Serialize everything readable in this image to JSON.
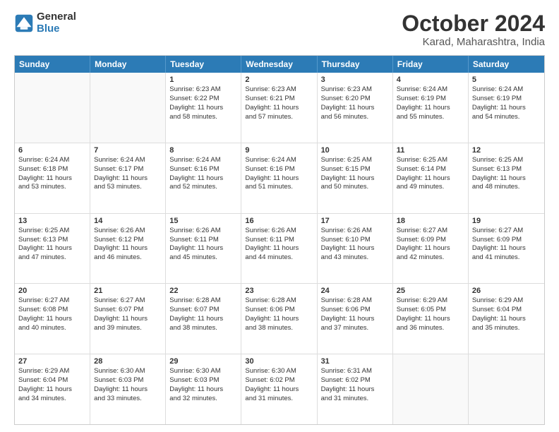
{
  "logo": {
    "line1": "General",
    "line2": "Blue"
  },
  "title": "October 2024",
  "subtitle": "Karad, Maharashtra, India",
  "weekdays": [
    "Sunday",
    "Monday",
    "Tuesday",
    "Wednesday",
    "Thursday",
    "Friday",
    "Saturday"
  ],
  "rows": [
    [
      {
        "day": "",
        "lines": [],
        "empty": true
      },
      {
        "day": "",
        "lines": [],
        "empty": true
      },
      {
        "day": "1",
        "lines": [
          "Sunrise: 6:23 AM",
          "Sunset: 6:22 PM",
          "Daylight: 11 hours",
          "and 58 minutes."
        ]
      },
      {
        "day": "2",
        "lines": [
          "Sunrise: 6:23 AM",
          "Sunset: 6:21 PM",
          "Daylight: 11 hours",
          "and 57 minutes."
        ]
      },
      {
        "day": "3",
        "lines": [
          "Sunrise: 6:23 AM",
          "Sunset: 6:20 PM",
          "Daylight: 11 hours",
          "and 56 minutes."
        ]
      },
      {
        "day": "4",
        "lines": [
          "Sunrise: 6:24 AM",
          "Sunset: 6:19 PM",
          "Daylight: 11 hours",
          "and 55 minutes."
        ]
      },
      {
        "day": "5",
        "lines": [
          "Sunrise: 6:24 AM",
          "Sunset: 6:19 PM",
          "Daylight: 11 hours",
          "and 54 minutes."
        ]
      }
    ],
    [
      {
        "day": "6",
        "lines": [
          "Sunrise: 6:24 AM",
          "Sunset: 6:18 PM",
          "Daylight: 11 hours",
          "and 53 minutes."
        ]
      },
      {
        "day": "7",
        "lines": [
          "Sunrise: 6:24 AM",
          "Sunset: 6:17 PM",
          "Daylight: 11 hours",
          "and 53 minutes."
        ]
      },
      {
        "day": "8",
        "lines": [
          "Sunrise: 6:24 AM",
          "Sunset: 6:16 PM",
          "Daylight: 11 hours",
          "and 52 minutes."
        ]
      },
      {
        "day": "9",
        "lines": [
          "Sunrise: 6:24 AM",
          "Sunset: 6:16 PM",
          "Daylight: 11 hours",
          "and 51 minutes."
        ]
      },
      {
        "day": "10",
        "lines": [
          "Sunrise: 6:25 AM",
          "Sunset: 6:15 PM",
          "Daylight: 11 hours",
          "and 50 minutes."
        ]
      },
      {
        "day": "11",
        "lines": [
          "Sunrise: 6:25 AM",
          "Sunset: 6:14 PM",
          "Daylight: 11 hours",
          "and 49 minutes."
        ]
      },
      {
        "day": "12",
        "lines": [
          "Sunrise: 6:25 AM",
          "Sunset: 6:13 PM",
          "Daylight: 11 hours",
          "and 48 minutes."
        ]
      }
    ],
    [
      {
        "day": "13",
        "lines": [
          "Sunrise: 6:25 AM",
          "Sunset: 6:13 PM",
          "Daylight: 11 hours",
          "and 47 minutes."
        ]
      },
      {
        "day": "14",
        "lines": [
          "Sunrise: 6:26 AM",
          "Sunset: 6:12 PM",
          "Daylight: 11 hours",
          "and 46 minutes."
        ]
      },
      {
        "day": "15",
        "lines": [
          "Sunrise: 6:26 AM",
          "Sunset: 6:11 PM",
          "Daylight: 11 hours",
          "and 45 minutes."
        ]
      },
      {
        "day": "16",
        "lines": [
          "Sunrise: 6:26 AM",
          "Sunset: 6:11 PM",
          "Daylight: 11 hours",
          "and 44 minutes."
        ]
      },
      {
        "day": "17",
        "lines": [
          "Sunrise: 6:26 AM",
          "Sunset: 6:10 PM",
          "Daylight: 11 hours",
          "and 43 minutes."
        ]
      },
      {
        "day": "18",
        "lines": [
          "Sunrise: 6:27 AM",
          "Sunset: 6:09 PM",
          "Daylight: 11 hours",
          "and 42 minutes."
        ]
      },
      {
        "day": "19",
        "lines": [
          "Sunrise: 6:27 AM",
          "Sunset: 6:09 PM",
          "Daylight: 11 hours",
          "and 41 minutes."
        ]
      }
    ],
    [
      {
        "day": "20",
        "lines": [
          "Sunrise: 6:27 AM",
          "Sunset: 6:08 PM",
          "Daylight: 11 hours",
          "and 40 minutes."
        ]
      },
      {
        "day": "21",
        "lines": [
          "Sunrise: 6:27 AM",
          "Sunset: 6:07 PM",
          "Daylight: 11 hours",
          "and 39 minutes."
        ]
      },
      {
        "day": "22",
        "lines": [
          "Sunrise: 6:28 AM",
          "Sunset: 6:07 PM",
          "Daylight: 11 hours",
          "and 38 minutes."
        ]
      },
      {
        "day": "23",
        "lines": [
          "Sunrise: 6:28 AM",
          "Sunset: 6:06 PM",
          "Daylight: 11 hours",
          "and 38 minutes."
        ]
      },
      {
        "day": "24",
        "lines": [
          "Sunrise: 6:28 AM",
          "Sunset: 6:06 PM",
          "Daylight: 11 hours",
          "and 37 minutes."
        ]
      },
      {
        "day": "25",
        "lines": [
          "Sunrise: 6:29 AM",
          "Sunset: 6:05 PM",
          "Daylight: 11 hours",
          "and 36 minutes."
        ]
      },
      {
        "day": "26",
        "lines": [
          "Sunrise: 6:29 AM",
          "Sunset: 6:04 PM",
          "Daylight: 11 hours",
          "and 35 minutes."
        ]
      }
    ],
    [
      {
        "day": "27",
        "lines": [
          "Sunrise: 6:29 AM",
          "Sunset: 6:04 PM",
          "Daylight: 11 hours",
          "and 34 minutes."
        ]
      },
      {
        "day": "28",
        "lines": [
          "Sunrise: 6:30 AM",
          "Sunset: 6:03 PM",
          "Daylight: 11 hours",
          "and 33 minutes."
        ]
      },
      {
        "day": "29",
        "lines": [
          "Sunrise: 6:30 AM",
          "Sunset: 6:03 PM",
          "Daylight: 11 hours",
          "and 32 minutes."
        ]
      },
      {
        "day": "30",
        "lines": [
          "Sunrise: 6:30 AM",
          "Sunset: 6:02 PM",
          "Daylight: 11 hours",
          "and 31 minutes."
        ]
      },
      {
        "day": "31",
        "lines": [
          "Sunrise: 6:31 AM",
          "Sunset: 6:02 PM",
          "Daylight: 11 hours",
          "and 31 minutes."
        ]
      },
      {
        "day": "",
        "lines": [],
        "empty": true
      },
      {
        "day": "",
        "lines": [],
        "empty": true
      }
    ]
  ]
}
